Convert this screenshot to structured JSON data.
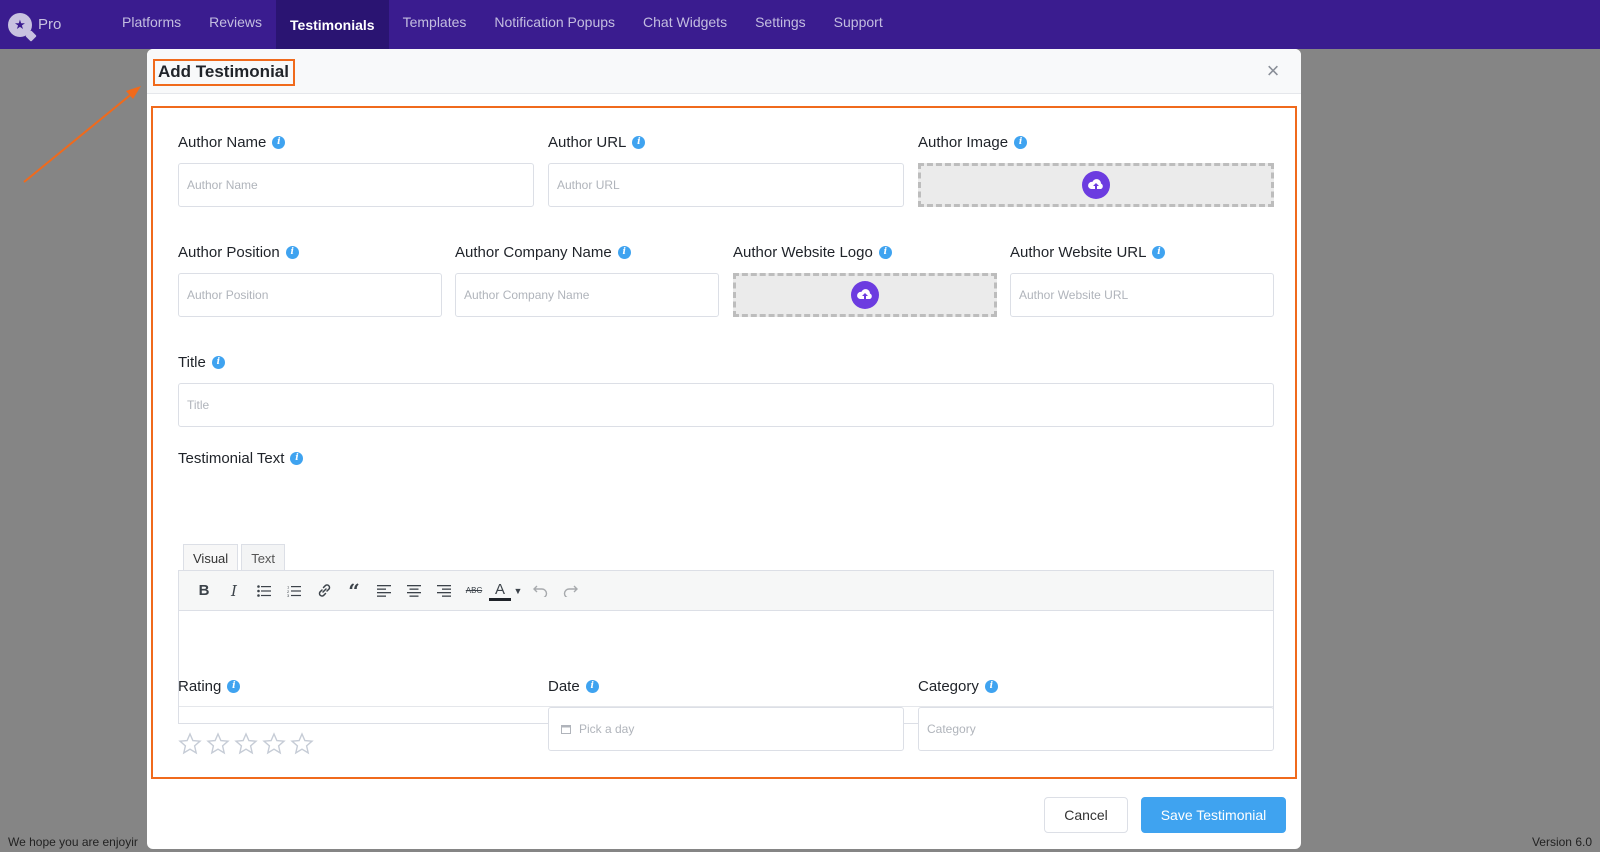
{
  "app": {
    "brand_text": "Pro",
    "brand_icon": "star-badge-icon",
    "nav": [
      {
        "label": "Platforms"
      },
      {
        "label": "Reviews"
      },
      {
        "label": "Testimonials"
      },
      {
        "label": "Templates"
      },
      {
        "label": "Notification Popups"
      },
      {
        "label": "Chat Widgets"
      },
      {
        "label": "Settings"
      },
      {
        "label": "Support"
      }
    ],
    "active_nav": "Testimonials",
    "footer_left": "We hope you are enjoyir",
    "footer_right": "Version 6.0"
  },
  "modal": {
    "title": "Add Testimonial",
    "fields": {
      "author_name": {
        "label": "Author Name",
        "placeholder": "Author Name"
      },
      "author_url": {
        "label": "Author URL",
        "placeholder": "Author URL"
      },
      "author_image": {
        "label": "Author Image"
      },
      "author_position": {
        "label": "Author Position",
        "placeholder": "Author Position"
      },
      "author_company": {
        "label": "Author Company Name",
        "placeholder": "Author Company Name"
      },
      "author_logo": {
        "label": "Author Website Logo"
      },
      "author_website_url": {
        "label": "Author Website URL",
        "placeholder": "Author Website URL"
      },
      "title": {
        "label": "Title",
        "placeholder": "Title"
      },
      "testimonial_text": {
        "label": "Testimonial Text"
      },
      "rating": {
        "label": "Rating",
        "value": 0,
        "max": 5
      },
      "date": {
        "label": "Date",
        "placeholder": "Pick a day"
      },
      "category": {
        "label": "Category",
        "placeholder": "Category"
      }
    },
    "editor": {
      "tabs": [
        {
          "label": "Visual"
        },
        {
          "label": "Text"
        }
      ],
      "toolbar_text_color_glyph": "A",
      "toolbar_strike_glyph": "ABC"
    },
    "buttons": {
      "cancel": "Cancel",
      "save": "Save Testimonial"
    }
  },
  "colors": {
    "nav_bg": "#3a1c8f",
    "highlight": "#f06a1c",
    "primary": "#3fa3f0",
    "upload_icon": "#6c3ce0"
  }
}
